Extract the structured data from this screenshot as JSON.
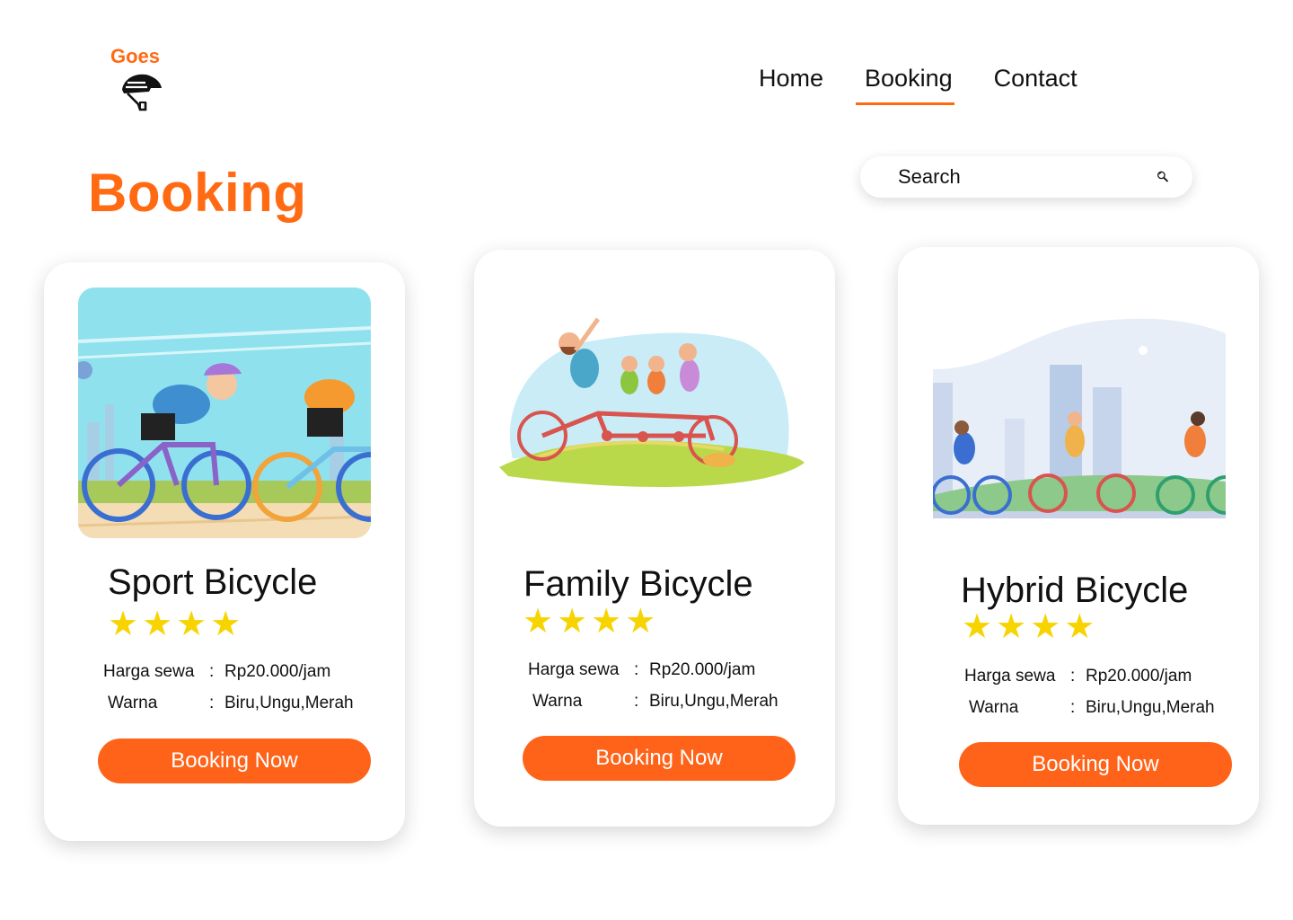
{
  "brand": {
    "name": "Goes",
    "icon": "helmet-icon",
    "accent_color": "#ff6a13"
  },
  "nav": {
    "items": [
      {
        "label": "Home",
        "active": false
      },
      {
        "label": "Booking",
        "active": true
      },
      {
        "label": "Contact",
        "active": false
      }
    ]
  },
  "page": {
    "title": "Booking"
  },
  "search": {
    "placeholder": "Search",
    "icon": "search-icon"
  },
  "cards": [
    {
      "name": "Sport Bicycle",
      "rating": 4,
      "price_label": "Harga sewa",
      "price": "Rp20.000/jam",
      "color_label": "Warna",
      "colors": "Biru,Ungu,Merah",
      "button": "Booking Now"
    },
    {
      "name": "Family Bicycle",
      "rating": 4,
      "price_label": "Harga sewa",
      "price": "Rp20.000/jam",
      "color_label": "Warna",
      "colors": "Biru,Ungu,Merah",
      "button": "Booking Now"
    },
    {
      "name": "Hybrid Bicycle",
      "rating": 4,
      "price_label": "Harga sewa",
      "price": "Rp20.000/jam",
      "color_label": "Warna",
      "colors": "Biru,Ungu,Merah",
      "button": "Booking Now"
    }
  ],
  "colors": {
    "button": "#ff6319",
    "star": "#f7d400"
  }
}
